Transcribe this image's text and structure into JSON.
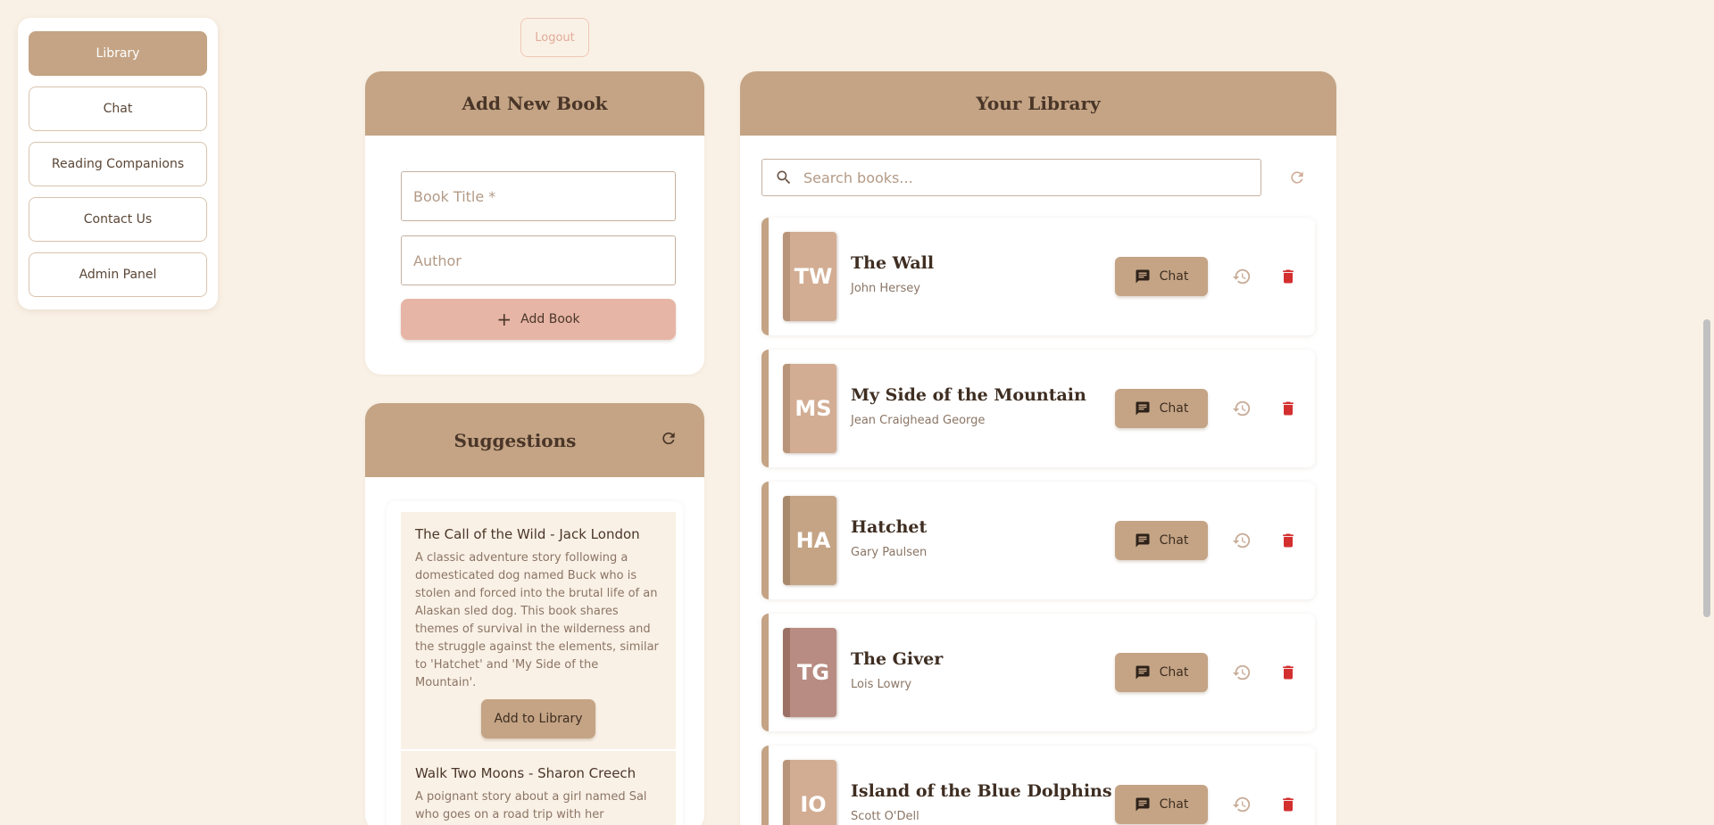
{
  "nav": {
    "items": [
      {
        "label": "Library",
        "active": true
      },
      {
        "label": "Chat",
        "active": false
      },
      {
        "label": "Reading Companions",
        "active": false
      },
      {
        "label": "Contact Us",
        "active": false
      },
      {
        "label": "Admin Panel",
        "active": false
      }
    ]
  },
  "header": {
    "logout_label": "Logout"
  },
  "add_book": {
    "title": "Add New Book",
    "title_placeholder": "Book Title *",
    "author_placeholder": "Author",
    "button_label": "Add Book"
  },
  "suggestions": {
    "title": "Suggestions",
    "items": [
      {
        "title": "The Call of the Wild - Jack London",
        "description": "A classic adventure story following a domesticated dog named Buck who is stolen and forced into the brutal life of an Alaskan sled dog. This book shares themes of survival in the wilderness and the struggle against the elements, similar to 'Hatchet' and 'My Side of the Mountain'.",
        "button_label": "Add to Library"
      },
      {
        "title": "Walk Two Moons - Sharon Creech",
        "description": "A poignant story about a girl named Sal who goes on a road trip with her"
      }
    ]
  },
  "library": {
    "title": "Your Library",
    "search_placeholder": "Search books...",
    "chat_label": "Chat",
    "books": [
      {
        "initials": "TW",
        "title": "The Wall",
        "author": "John Hersey"
      },
      {
        "initials": "MS",
        "title": "My Side of the Mountain",
        "author": "Jean Craighead George"
      },
      {
        "initials": "HA",
        "title": "Hatchet",
        "author": "Gary Paulsen"
      },
      {
        "initials": "TG",
        "title": "The Giver",
        "author": "Lois Lowry"
      },
      {
        "initials": "IO",
        "title": "Island of the Blue Dolphins",
        "author": "Scott O'Dell"
      }
    ]
  },
  "colors": {
    "background": "#faf1e6",
    "accent": "#c4a485",
    "add_button": "#e6b5a6",
    "delete": "#d32f2f"
  }
}
